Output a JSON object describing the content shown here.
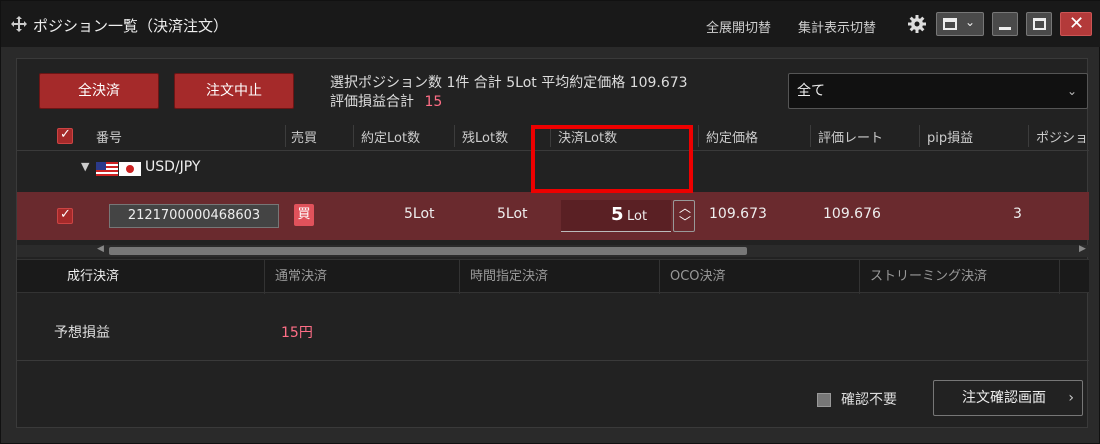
{
  "window": {
    "title": "ポジション一覧（決済注文）",
    "links": [
      "全展開切替",
      "集計表示切替"
    ]
  },
  "toolbar": {
    "close_all_label": "全決済",
    "cancel_order_label": "注文中止",
    "summary_line1": "選択ポジション数 1件 合計 5Lot 平均約定価格 109.673",
    "summary_pl_label": "評価損益合計",
    "summary_pl_value": "15",
    "filter_value": "全て"
  },
  "table": {
    "headers": [
      "番号",
      "売買",
      "約定Lot数",
      "残Lot数",
      "決済Lot数",
      "約定価格",
      "評価レート",
      "pip損益",
      "ポジショ"
    ],
    "group_label": "USD/JPY",
    "row": {
      "id": "2121700000468603",
      "side": "買",
      "filled_lot": "5Lot",
      "remaining_lot": "5Lot",
      "settle_lot_value": "5",
      "settle_lot_unit": "Lot",
      "filled_price": "109.673",
      "eval_rate": "109.676",
      "pip_pl": "3"
    }
  },
  "tabs": [
    "成行決済",
    "通常決済",
    "時間指定決済",
    "OCO決済",
    "ストリーミング決済"
  ],
  "expected": {
    "label": "予想損益",
    "value": "15円"
  },
  "footer": {
    "skip_confirm_label": "確認不要",
    "confirm_button_label": "注文確認画面"
  },
  "colors": {
    "accent_red": "#a52a2a",
    "row_highlight": "#6a2a2e",
    "profit_pink": "#ff6e86",
    "annotation_red": "#e00000"
  }
}
